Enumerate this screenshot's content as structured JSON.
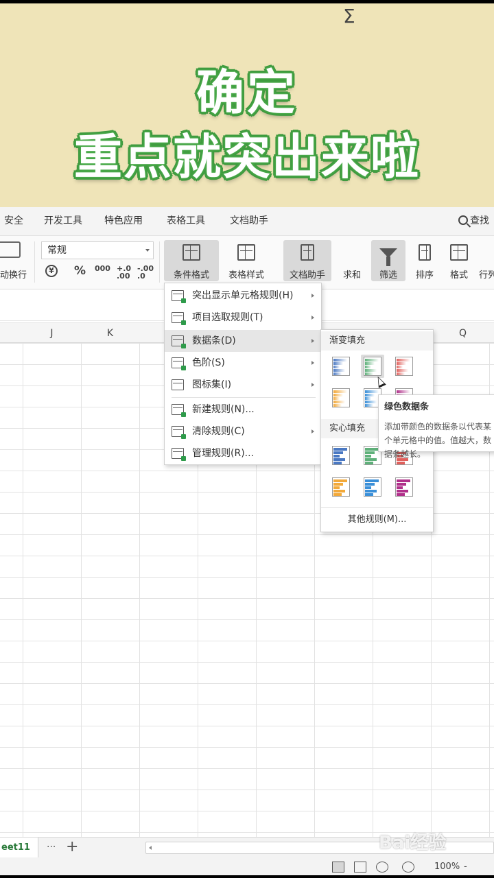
{
  "banner": {
    "line1": "确定",
    "line2": "重点就突出来啦"
  },
  "tabs": [
    "安全",
    "开发工具",
    "特色应用",
    "表格工具",
    "文档助手"
  ],
  "search": {
    "label": "查找"
  },
  "ribbon": {
    "wrap_label": "动换行",
    "number_format": "常规",
    "percent": "%",
    "thousands": "000",
    "dec_inc": "+.0 .00",
    "dec_dec": "-.00 .0",
    "cond_format": "条件格式",
    "table_style": "表格样式",
    "doc_helper": "文档助手",
    "sum": "求和",
    "filter": "筛选",
    "sort": "排序",
    "format": "格式",
    "row_col": "行列"
  },
  "columns": [
    "J",
    "K",
    "Q"
  ],
  "cf_menu": [
    {
      "label": "突出显示单元格规则(H)"
    },
    {
      "label": "项目选取规则(T)"
    },
    {
      "label": "数据条(D)"
    },
    {
      "label": "色阶(S)"
    },
    {
      "label": "图标集(I)"
    },
    {
      "label": "新建规则(N)..."
    },
    {
      "label": "清除规则(C)"
    },
    {
      "label": "管理规则(R)..."
    }
  ],
  "databar_menu": {
    "gradient_header": "渐变填充",
    "solid_header": "实心填充",
    "other_rules": "其他规则(M)...",
    "swatch_colors": {
      "blue": "#4a78c2",
      "green": "#5fb07a",
      "red": "#e0605c",
      "orange": "#f2a93a",
      "lightblue": "#3a8fd8",
      "purple": "#b0308a"
    }
  },
  "tooltip": {
    "title": "绿色数据条",
    "body": "添加带颜色的数据条以代表某个单元格中的值。值越大，数据条越长。"
  },
  "sheet": {
    "name": "eet11",
    "more": "···",
    "add": "+"
  },
  "status": {
    "zoom": "100%",
    "zoom_minus": "-"
  },
  "watermark": "Bai经验"
}
